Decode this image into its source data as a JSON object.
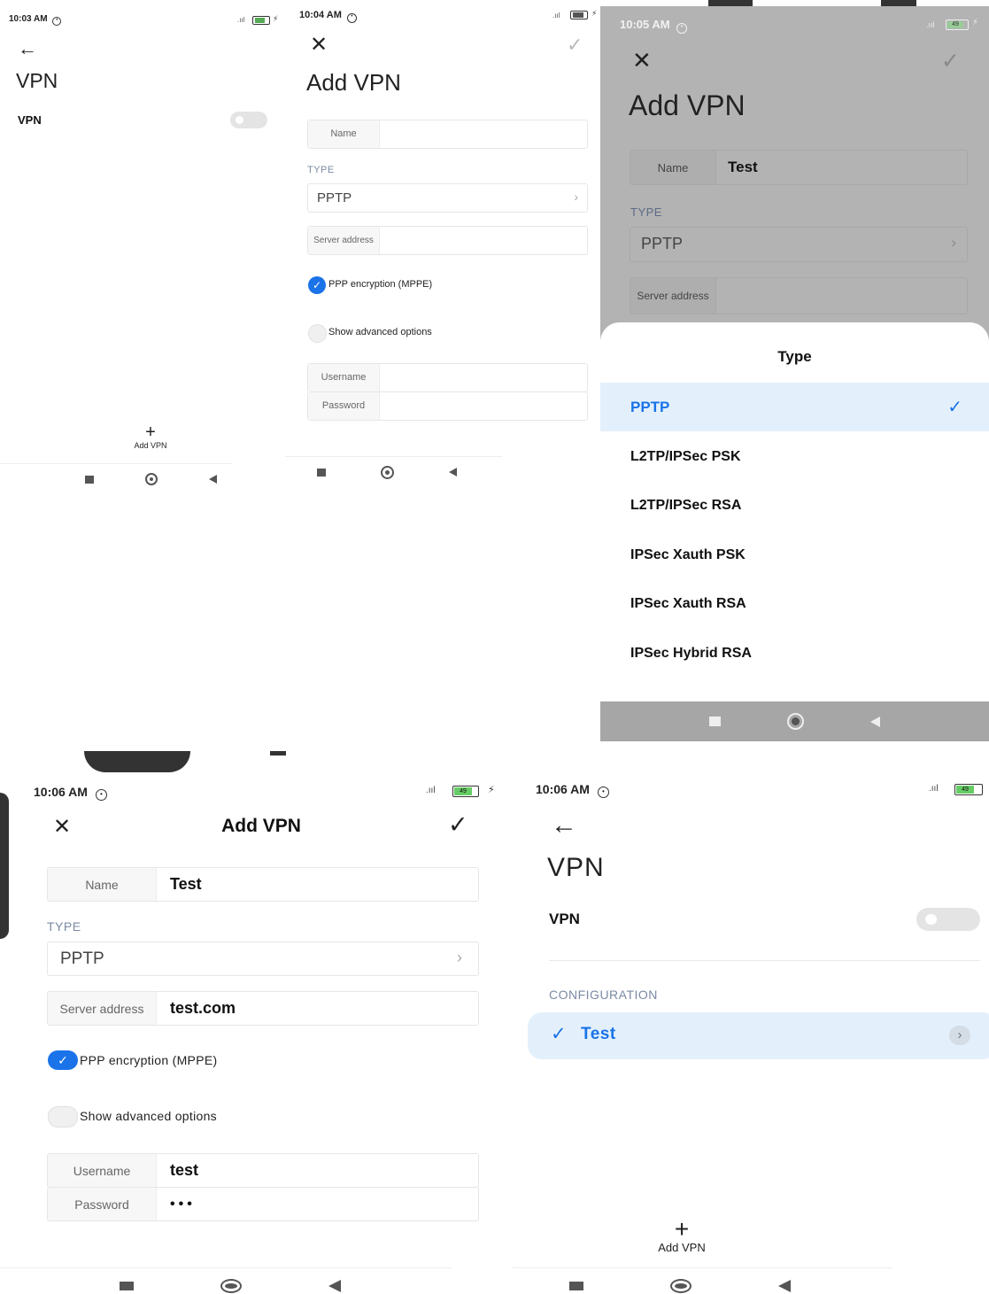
{
  "screen1": {
    "time": "10:03 AM",
    "title": "VPN",
    "vpn_label": "VPN",
    "add_vpn_label": "Add VPN",
    "back_icon": "back-arrow-icon"
  },
  "screen2": {
    "time": "10:04 AM",
    "title": "Add VPN",
    "name_label": "Name",
    "name_value": "",
    "type_section": "TYPE",
    "type_value": "PPTP",
    "server_label": "Server address",
    "server_value": "",
    "ppp_label": "PPP encryption (MPPE)",
    "advanced_label": "Show advanced options",
    "username_label": "Username",
    "password_label": "Password"
  },
  "screen3": {
    "time": "10:05 AM",
    "title": "Add VPN",
    "name_label": "Name",
    "name_value": "Test",
    "type_section": "TYPE",
    "type_value": "PPTP",
    "server_label": "Server address",
    "battery": "49",
    "sheet": {
      "title": "Type",
      "items": [
        "PPTP",
        "L2TP/IPSec PSK",
        "L2TP/IPSec RSA",
        "IPSec Xauth PSK",
        "IPSec Xauth RSA",
        "IPSec Hybrid RSA"
      ],
      "selected_index": 0
    }
  },
  "screen4": {
    "time": "10:06 AM",
    "title": "Add VPN",
    "battery": "49",
    "name_label": "Name",
    "name_value": "Test",
    "type_section": "TYPE",
    "type_value": "PPTP",
    "server_label": "Server address",
    "server_value": "test.com",
    "ppp_label": "PPP encryption (MPPE)",
    "advanced_label": "Show advanced options",
    "username_label": "Username",
    "username_value": "test",
    "password_label": "Password",
    "password_value": "•••"
  },
  "screen5": {
    "time": "10:06 AM",
    "battery": "49",
    "title": "VPN",
    "vpn_label": "VPN",
    "config_section": "CONFIGURATION",
    "config_item": "Test",
    "add_vpn_label": "Add VPN"
  },
  "colors": {
    "accent": "#1a73e8",
    "selected_bg": "#e3f0fc",
    "dim_overlay": "#b3b3b3",
    "section_label": "#7b8aa3"
  }
}
